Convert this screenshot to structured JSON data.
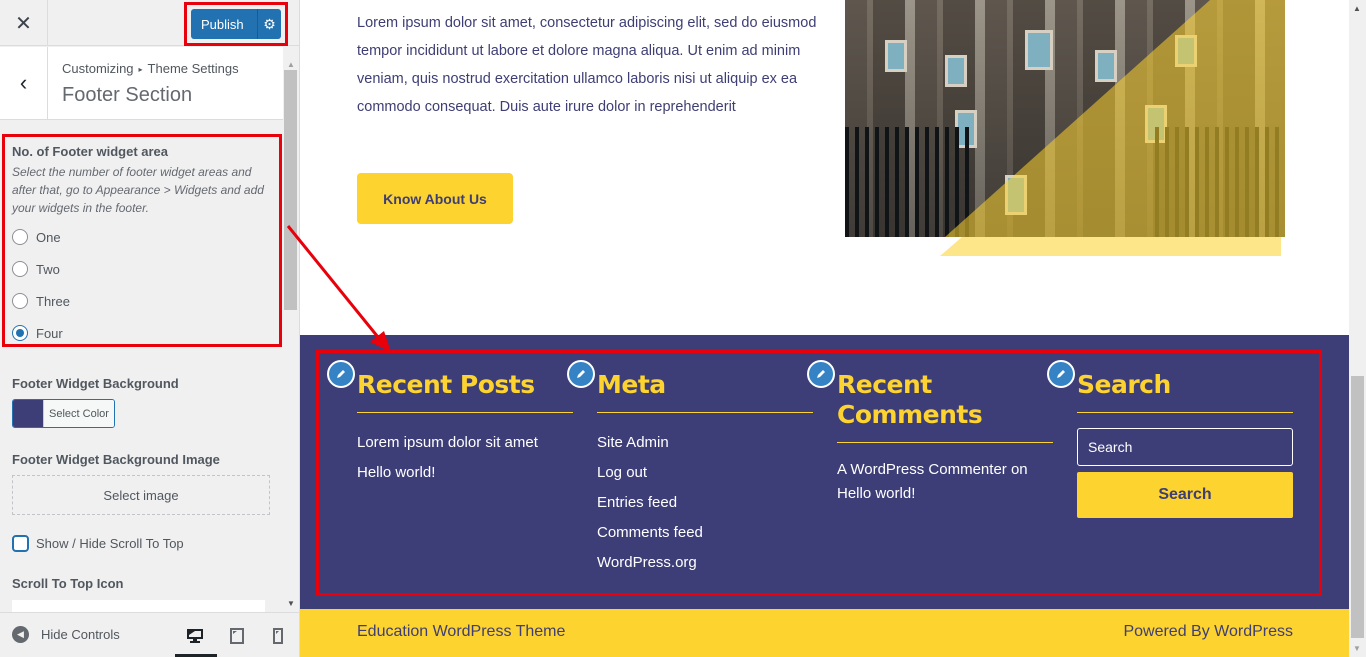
{
  "customizer": {
    "close_icon": "close-icon",
    "publish_label": "Publish",
    "settings_icon": "gear-icon",
    "breadcrumb": {
      "root": "Customizing",
      "separator": "▸",
      "parent": "Theme Settings"
    },
    "section_title": "Footer Section",
    "footer_widget_area": {
      "title": "No. of Footer widget area",
      "description": "Select the number of footer widget areas and after that, go to Appearance > Widgets and add your widgets in the footer.",
      "options": [
        {
          "label": "One",
          "checked": false
        },
        {
          "label": "Two",
          "checked": false
        },
        {
          "label": "Three",
          "checked": false
        },
        {
          "label": "Four",
          "checked": true
        }
      ]
    },
    "footer_widget_background": {
      "label": "Footer Widget Background",
      "button_label": "Select Color",
      "color": "#3d3d78"
    },
    "footer_widget_background_image": {
      "label": "Footer Widget Background Image",
      "button_label": "Select image"
    },
    "scroll_to_top_toggle": {
      "label": "Show / Hide Scroll To Top",
      "checked": false
    },
    "scroll_to_top_icon": {
      "label": "Scroll To Top Icon"
    },
    "footer_controls": {
      "hide_controls_label": "Hide Controls",
      "devices": [
        {
          "name": "desktop",
          "active": true
        },
        {
          "name": "tablet",
          "active": false
        },
        {
          "name": "mobile",
          "active": false
        }
      ]
    }
  },
  "preview": {
    "about": {
      "text": "Lorem ipsum dolor sit amet, consectetur adipiscing elit, sed do eiusmod tempor incididunt ut labore et dolore magna aliqua. Ut enim ad minim veniam, quis nostrud exercitation ullamco laboris nisi ut aliquip ex ea commodo consequat. Duis aute irure dolor in reprehenderit",
      "button_label": "Know About Us"
    },
    "widgets": [
      {
        "title": "Recent Posts",
        "items": [
          "Lorem ipsum dolor sit amet",
          "Hello world!"
        ]
      },
      {
        "title": "Meta",
        "items": [
          "Site Admin",
          "Log out",
          "Entries feed",
          "Comments feed",
          "WordPress.org"
        ]
      },
      {
        "title": "Recent Comments",
        "comment": "A WordPress Commenter on Hello world!"
      },
      {
        "title": "Search",
        "placeholder": "Search",
        "button_label": "Search"
      }
    ],
    "copyright": {
      "left": "Education WordPress Theme",
      "right": "Powered By WordPress"
    }
  },
  "colors": {
    "primary": "#3d3d78",
    "accent": "#fdd32f",
    "wp_blue": "#2271b1",
    "annotation_red": "#e8000b"
  }
}
